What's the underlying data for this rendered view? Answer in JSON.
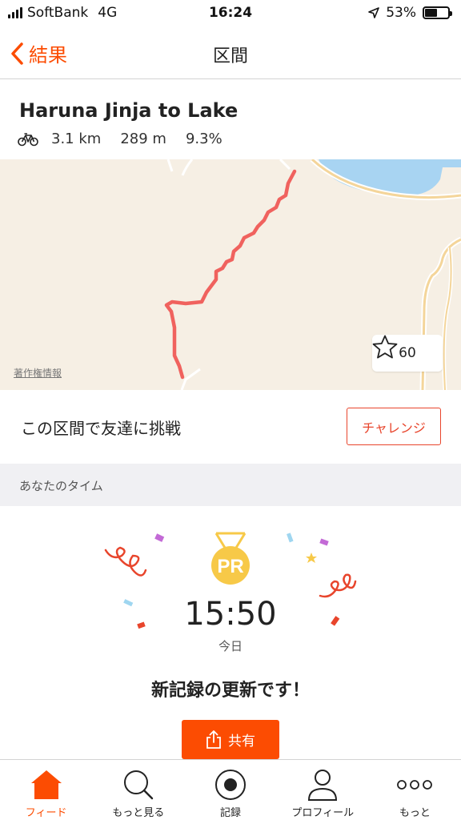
{
  "status_bar": {
    "carrier": "SoftBank",
    "network": "4G",
    "time": "16:24",
    "battery_pct": "53%",
    "battery_level": 0.53
  },
  "nav": {
    "back_label": "結果",
    "title": "区間"
  },
  "segment": {
    "name": "Haruna Jinja to Lake",
    "activity_icon": "bicycle-icon",
    "distance": "3.1 km",
    "elevation": "289 m",
    "grade": "9.3%"
  },
  "map": {
    "attribution": "著作権情報",
    "star_count": "60",
    "route_color": "#f0625e"
  },
  "challenge": {
    "text": "この区間で友達に挑戦",
    "button_label": "チャレンジ"
  },
  "your_time": {
    "section_label": "あなたのタイム",
    "medal_label": "PR",
    "time": "15:50",
    "date": "今日",
    "message": "新記録の更新です！",
    "share_label": "共有"
  },
  "tabs": [
    {
      "label": "フィード",
      "icon": "home-icon",
      "active": true
    },
    {
      "label": "もっと見る",
      "icon": "search-icon",
      "active": false
    },
    {
      "label": "記録",
      "icon": "record-icon",
      "active": false
    },
    {
      "label": "プロフィール",
      "icon": "profile-icon",
      "active": false
    },
    {
      "label": "もっと",
      "icon": "more-icon",
      "active": false
    }
  ],
  "colors": {
    "accent": "#fc4c02",
    "challenge_red": "#e8452c",
    "gold": "#f7c948"
  }
}
